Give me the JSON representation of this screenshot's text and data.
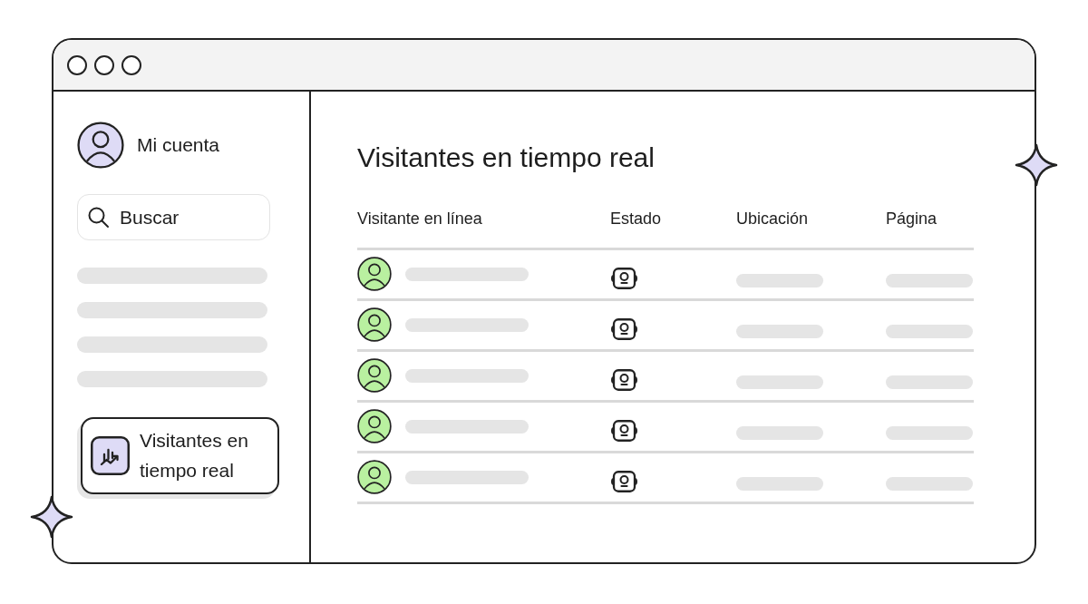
{
  "sidebar": {
    "account": {
      "label": "Mi cuenta"
    },
    "search": {
      "placeholder": "Buscar"
    },
    "nav_items": [
      {
        "kind": "skeleton"
      },
      {
        "kind": "skeleton"
      },
      {
        "kind": "skeleton"
      },
      {
        "kind": "skeleton"
      },
      {
        "kind": "link",
        "label": "Visitantes en tiempo real",
        "selected": true
      }
    ]
  },
  "main": {
    "title": "Visitantes en tiempo real",
    "table": {
      "columns": [
        "Visitante en línea",
        "Estado",
        "Ubicación",
        "Página"
      ],
      "rows": [
        {
          "kind": "skeleton"
        },
        {
          "kind": "skeleton"
        },
        {
          "kind": "skeleton"
        },
        {
          "kind": "skeleton"
        },
        {
          "kind": "skeleton"
        }
      ]
    }
  }
}
